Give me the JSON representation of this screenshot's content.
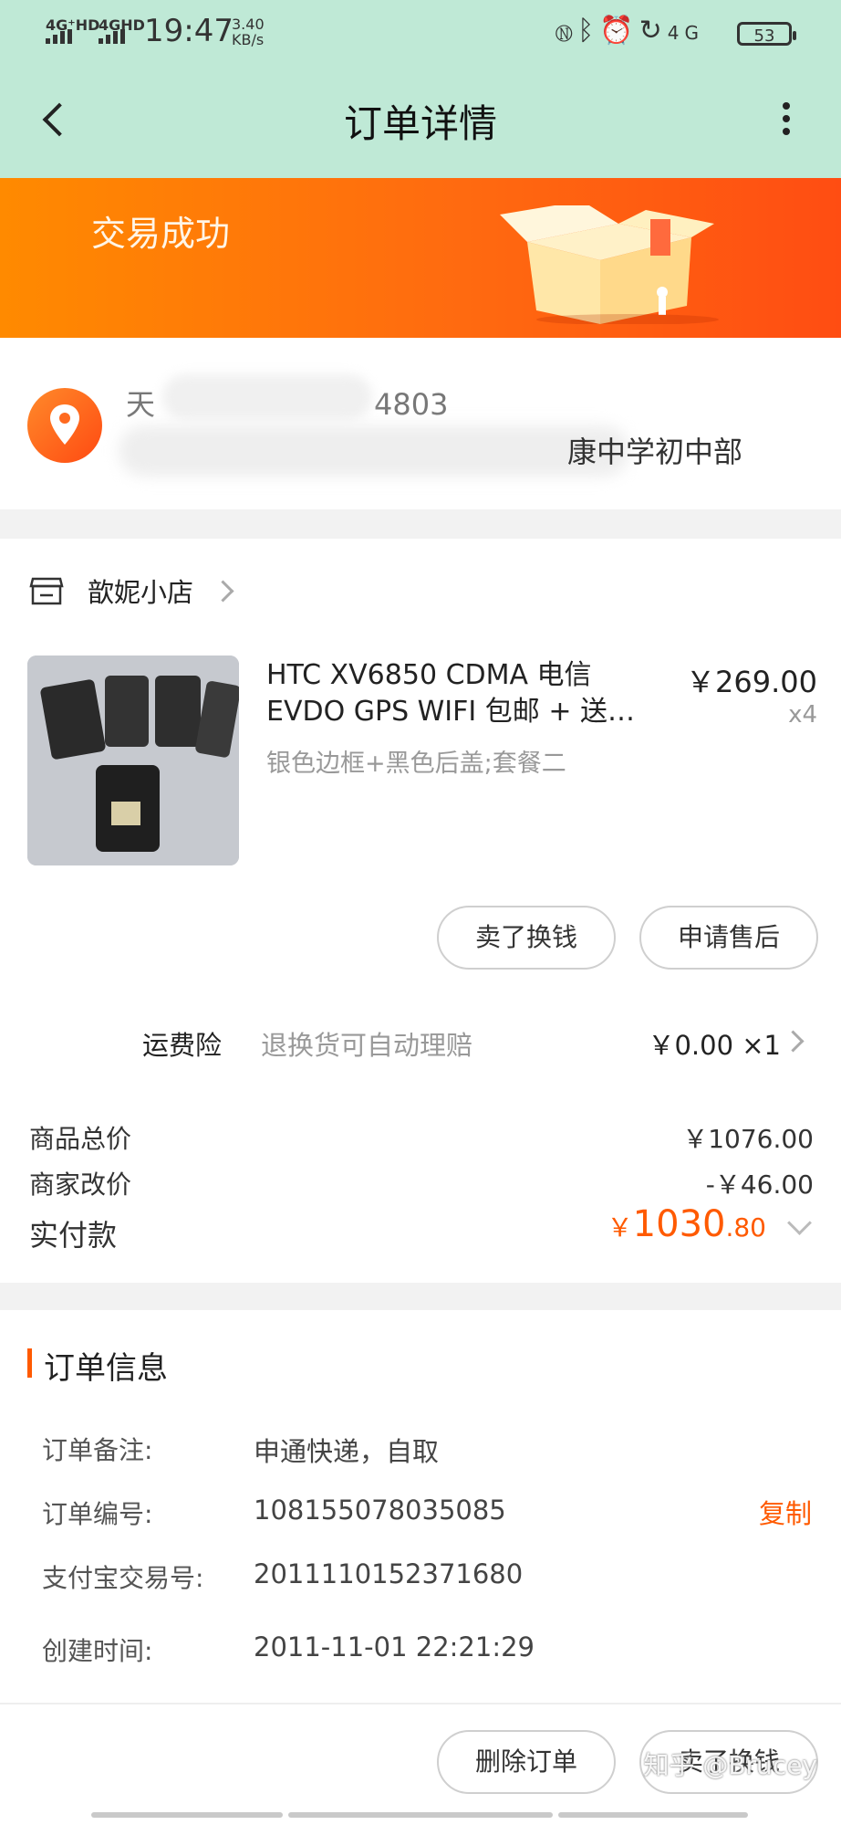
{
  "status_bar": {
    "signal1": "4G⁺HD",
    "signal2": "4GHD",
    "time": "19:47",
    "speed_value": "3.40",
    "speed_unit": "KB/s",
    "battery": "53"
  },
  "nav": {
    "title": "订单详情"
  },
  "banner": {
    "status": "交易成功"
  },
  "address": {
    "name_partial": "天",
    "phone_partial": "4803",
    "address_partial": "康中学初中部"
  },
  "shop": {
    "name": "歆妮小店"
  },
  "item": {
    "title": "HTC XV6850 CDMA 电信 EVDO  GPS WIFI 包邮 + 送…",
    "price": "￥269.00",
    "qty": "x4",
    "sku": "银色边框+黑色后盖;套餐二"
  },
  "item_actions": {
    "sell": "卖了换钱",
    "after_sale": "申请售后"
  },
  "insurance": {
    "label": "运费险",
    "desc": "退换货可自动理赔",
    "price": "￥0.00 ×1"
  },
  "summary": {
    "total_label": "商品总价",
    "total_value": "￥1076.00",
    "adjust_label": "商家改价",
    "adjust_value": "-￥46.00",
    "paid_label": "实付款",
    "paid_currency": "￥",
    "paid_int": "1030",
    "paid_dec": ".80"
  },
  "order_info": {
    "title": "订单信息",
    "rows": [
      {
        "label": "订单备注:",
        "value": "申通快递，自取"
      },
      {
        "label": "订单编号:",
        "value": "108155078035085"
      },
      {
        "label": "支付宝交易号:",
        "value": "2011110152371680"
      },
      {
        "label": "创建时间:",
        "value": "2011-11-01 22:21:29"
      }
    ],
    "copy": "复制"
  },
  "bottom_bar": {
    "delete": "删除订单",
    "sell": "卖了换钱",
    "watermark": "知乎 @Brucey"
  },
  "colors": {
    "accent": "#ff5a00",
    "header_bg": "#bfe9d6"
  }
}
